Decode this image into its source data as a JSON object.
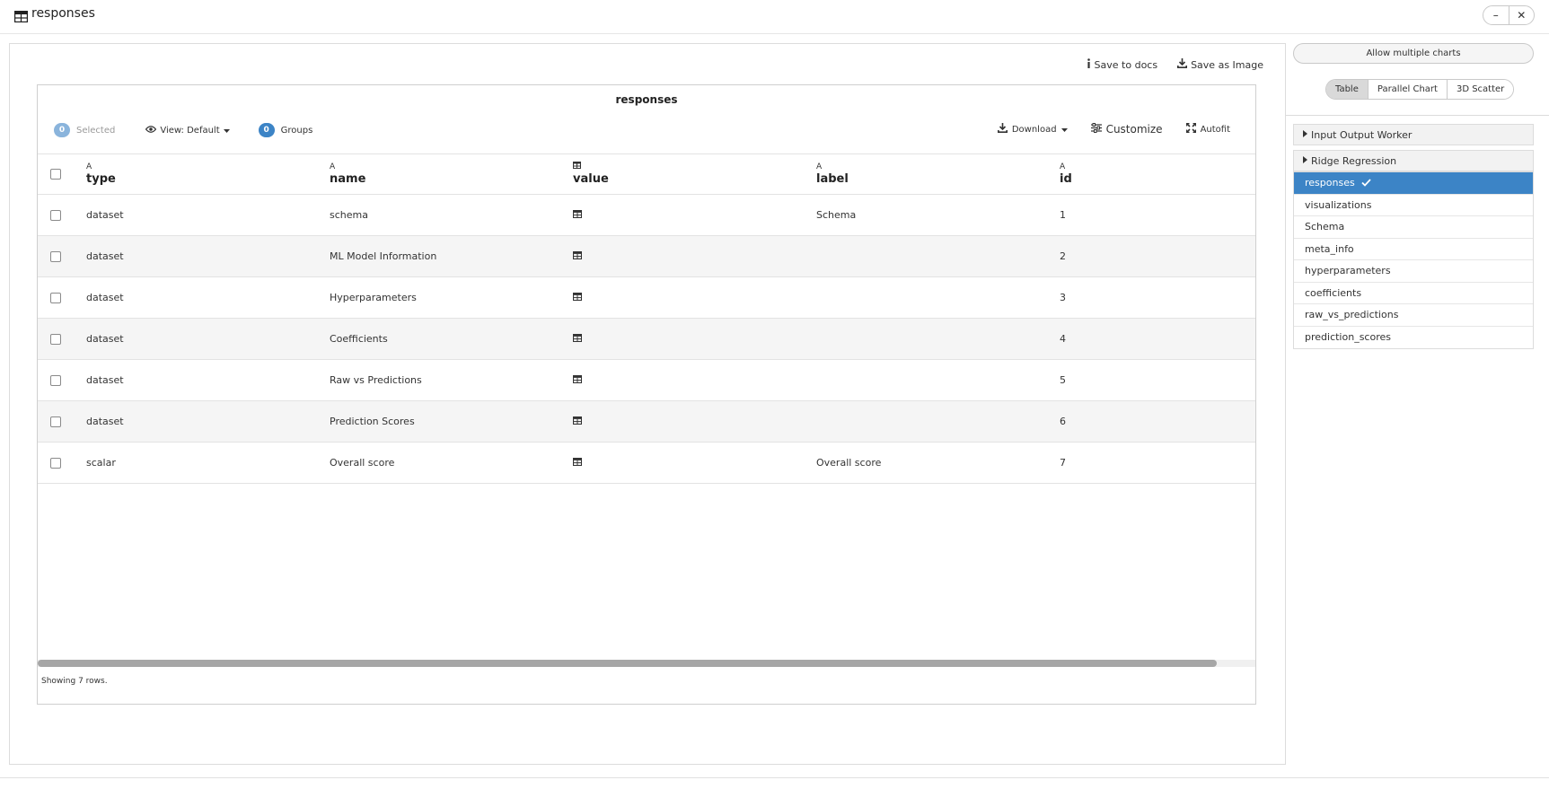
{
  "window": {
    "title": "responses",
    "minimize_label": "–",
    "close_label": "✕"
  },
  "actions": {
    "save_to_docs": "Save to docs",
    "save_as_image": "Save as Image"
  },
  "grid": {
    "title": "responses",
    "selected_count": "0",
    "selected_label": "Selected",
    "view_label": "View: Default",
    "groups_count": "0",
    "groups_label": "Groups",
    "download_label": "Download",
    "customize_label": "Customize",
    "autofit_label": "Autofit",
    "columns": [
      {
        "type_icon": "A",
        "name": "type"
      },
      {
        "type_icon": "table-icon",
        "name": "name",
        "type_glyph": "A"
      },
      {
        "type_icon": "table-icon",
        "name": "value"
      },
      {
        "type_icon": "A",
        "name": "label"
      },
      {
        "type_icon": "A",
        "name": "id"
      }
    ],
    "column_type_glyphs": [
      "A",
      "A",
      "",
      "A",
      "A"
    ],
    "rows": [
      {
        "type": "dataset",
        "name": "schema",
        "label": "Schema",
        "id": "1"
      },
      {
        "type": "dataset",
        "name": "ML Model Information",
        "label": "",
        "id": "2"
      },
      {
        "type": "dataset",
        "name": "Hyperparameters",
        "label": "",
        "id": "3"
      },
      {
        "type": "dataset",
        "name": "Coefficients",
        "label": "",
        "id": "4"
      },
      {
        "type": "dataset",
        "name": "Raw vs Predictions",
        "label": "",
        "id": "5"
      },
      {
        "type": "dataset",
        "name": "Prediction Scores",
        "label": "",
        "id": "6"
      },
      {
        "type": "scalar",
        "name": "Overall score",
        "label": "Overall score",
        "id": "7"
      }
    ],
    "footer": "Showing 7 rows."
  },
  "side": {
    "allow_multiple": "Allow multiple charts",
    "tabs": [
      "Table",
      "Parallel Chart",
      "3D Scatter"
    ],
    "active_tab": "Table",
    "sections": [
      "Input Output Worker",
      "Ridge Regression"
    ],
    "items": [
      "responses",
      "visualizations",
      "Schema",
      "meta_info",
      "hyperparameters",
      "coefficients",
      "raw_vs_predictions",
      "prediction_scores"
    ],
    "active_item": "responses"
  },
  "colors": {
    "accent": "#3c84c6",
    "badge_light": "#8ab4dc",
    "row_alt": "#f5f5f5"
  }
}
